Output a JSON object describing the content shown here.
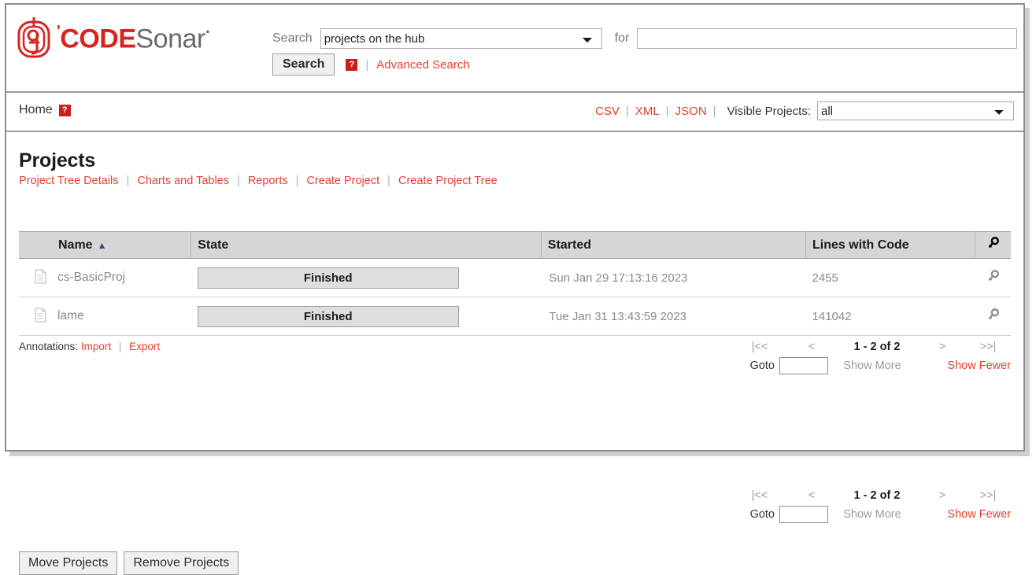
{
  "header": {
    "logo": {
      "tick": "'",
      "code": "CODE",
      "sonar": "Sonar",
      "dot": "·"
    },
    "search_label": "Search",
    "search_scope": "projects on the hub",
    "for_label": "for",
    "for_value": "",
    "search_button": "Search",
    "help_badge": "?",
    "separator": "|",
    "advanced_search": "Advanced Search"
  },
  "navbar": {
    "home": "Home",
    "help_badge": "?",
    "csv": "CSV",
    "xml": "XML",
    "json": "JSON",
    "separator": "|",
    "visible_projects_label": "Visible Projects:",
    "visible_projects_value": "all"
  },
  "main": {
    "title": "Projects",
    "separator": "|",
    "action_links": [
      "Project Tree Details",
      "Charts and Tables",
      "Reports",
      "Create Project",
      "Create Project Tree"
    ]
  },
  "pager": {
    "first": "|<<",
    "prev": "<",
    "count": "1 - 2 of 2",
    "next": ">",
    "last": ">>|",
    "goto_label": "Goto",
    "goto_value": "",
    "show_more": "Show More",
    "show_fewer": "Show Fewer"
  },
  "table": {
    "columns": [
      "Name",
      "State",
      "Started",
      "Lines with Code"
    ],
    "sort_arrow": "▲",
    "rows": [
      {
        "name": "cs-BasicProj",
        "state": "Finished",
        "started": "Sun Jan 29 17:13:16 2023",
        "lines_with_code": "2455"
      },
      {
        "name": "lame",
        "state": "Finished",
        "started": "Tue Jan 31 13:43:59 2023",
        "lines_with_code": "141042"
      }
    ]
  },
  "footer": {
    "annotations_label": "Annotations:",
    "import": "Import",
    "export": "Export",
    "separator": "|",
    "move_projects": "Move Projects",
    "remove_projects": "Remove Projects"
  },
  "colors": {
    "brand_red": "#d8241f",
    "link_red": "#e2402f",
    "disabled_gray": "#9b9b9b",
    "sort_blue": "#2d4f73"
  }
}
